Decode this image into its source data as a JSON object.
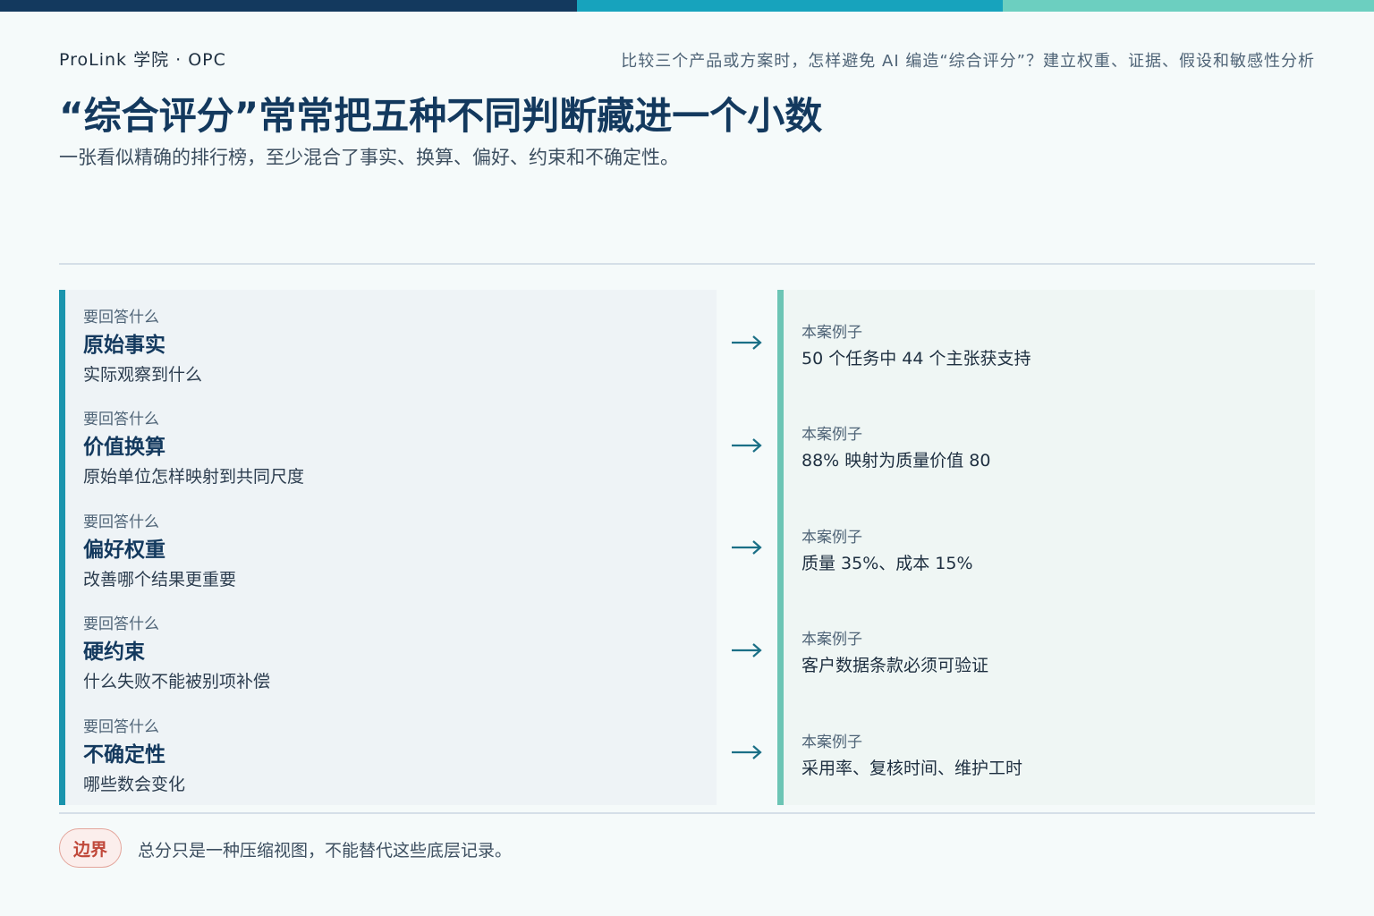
{
  "header": {
    "brand": "ProLink 学院 · OPC",
    "topic": "比较三个产品或方案时，怎样避免 AI 编造“综合评分”？建立权重、证据、假设和敏感性分析"
  },
  "title": "“综合评分”常常把五种不同判断藏进一个小数",
  "subtitle": "一张看似精确的排行榜，至少混合了事实、换算、偏好、约束和不确定性。",
  "colors": {
    "navy": "#13395e",
    "teal": "#1a94ad",
    "mint": "#6cc5b5",
    "badge_red": "#c0483a"
  },
  "rows": [
    {
      "q_label": "要回答什么",
      "q_title": "原始事实",
      "q_desc": "实际观察到什么",
      "e_label": "本案例子",
      "e_text": "50 个任务中 44 个主张获支持"
    },
    {
      "q_label": "要回答什么",
      "q_title": "价值换算",
      "q_desc": "原始单位怎样映射到共同尺度",
      "e_label": "本案例子",
      "e_text": "88% 映射为质量价值 80"
    },
    {
      "q_label": "要回答什么",
      "q_title": "偏好权重",
      "q_desc": "改善哪个结果更重要",
      "e_label": "本案例子",
      "e_text": "质量 35%、成本 15%"
    },
    {
      "q_label": "要回答什么",
      "q_title": "硬约束",
      "q_desc": "什么失败不能被别项补偿",
      "e_label": "本案例子",
      "e_text": "客户数据条款必须可验证"
    },
    {
      "q_label": "要回答什么",
      "q_title": "不确定性",
      "q_desc": "哪些数会变化",
      "e_label": "本案例子",
      "e_text": "采用率、复核时间、维护工时"
    }
  ],
  "footer": {
    "badge": "边界",
    "text": "总分只是一种压缩视图，不能替代这些底层记录。"
  },
  "icons": {
    "row_arrow": "arrow-right-icon"
  }
}
